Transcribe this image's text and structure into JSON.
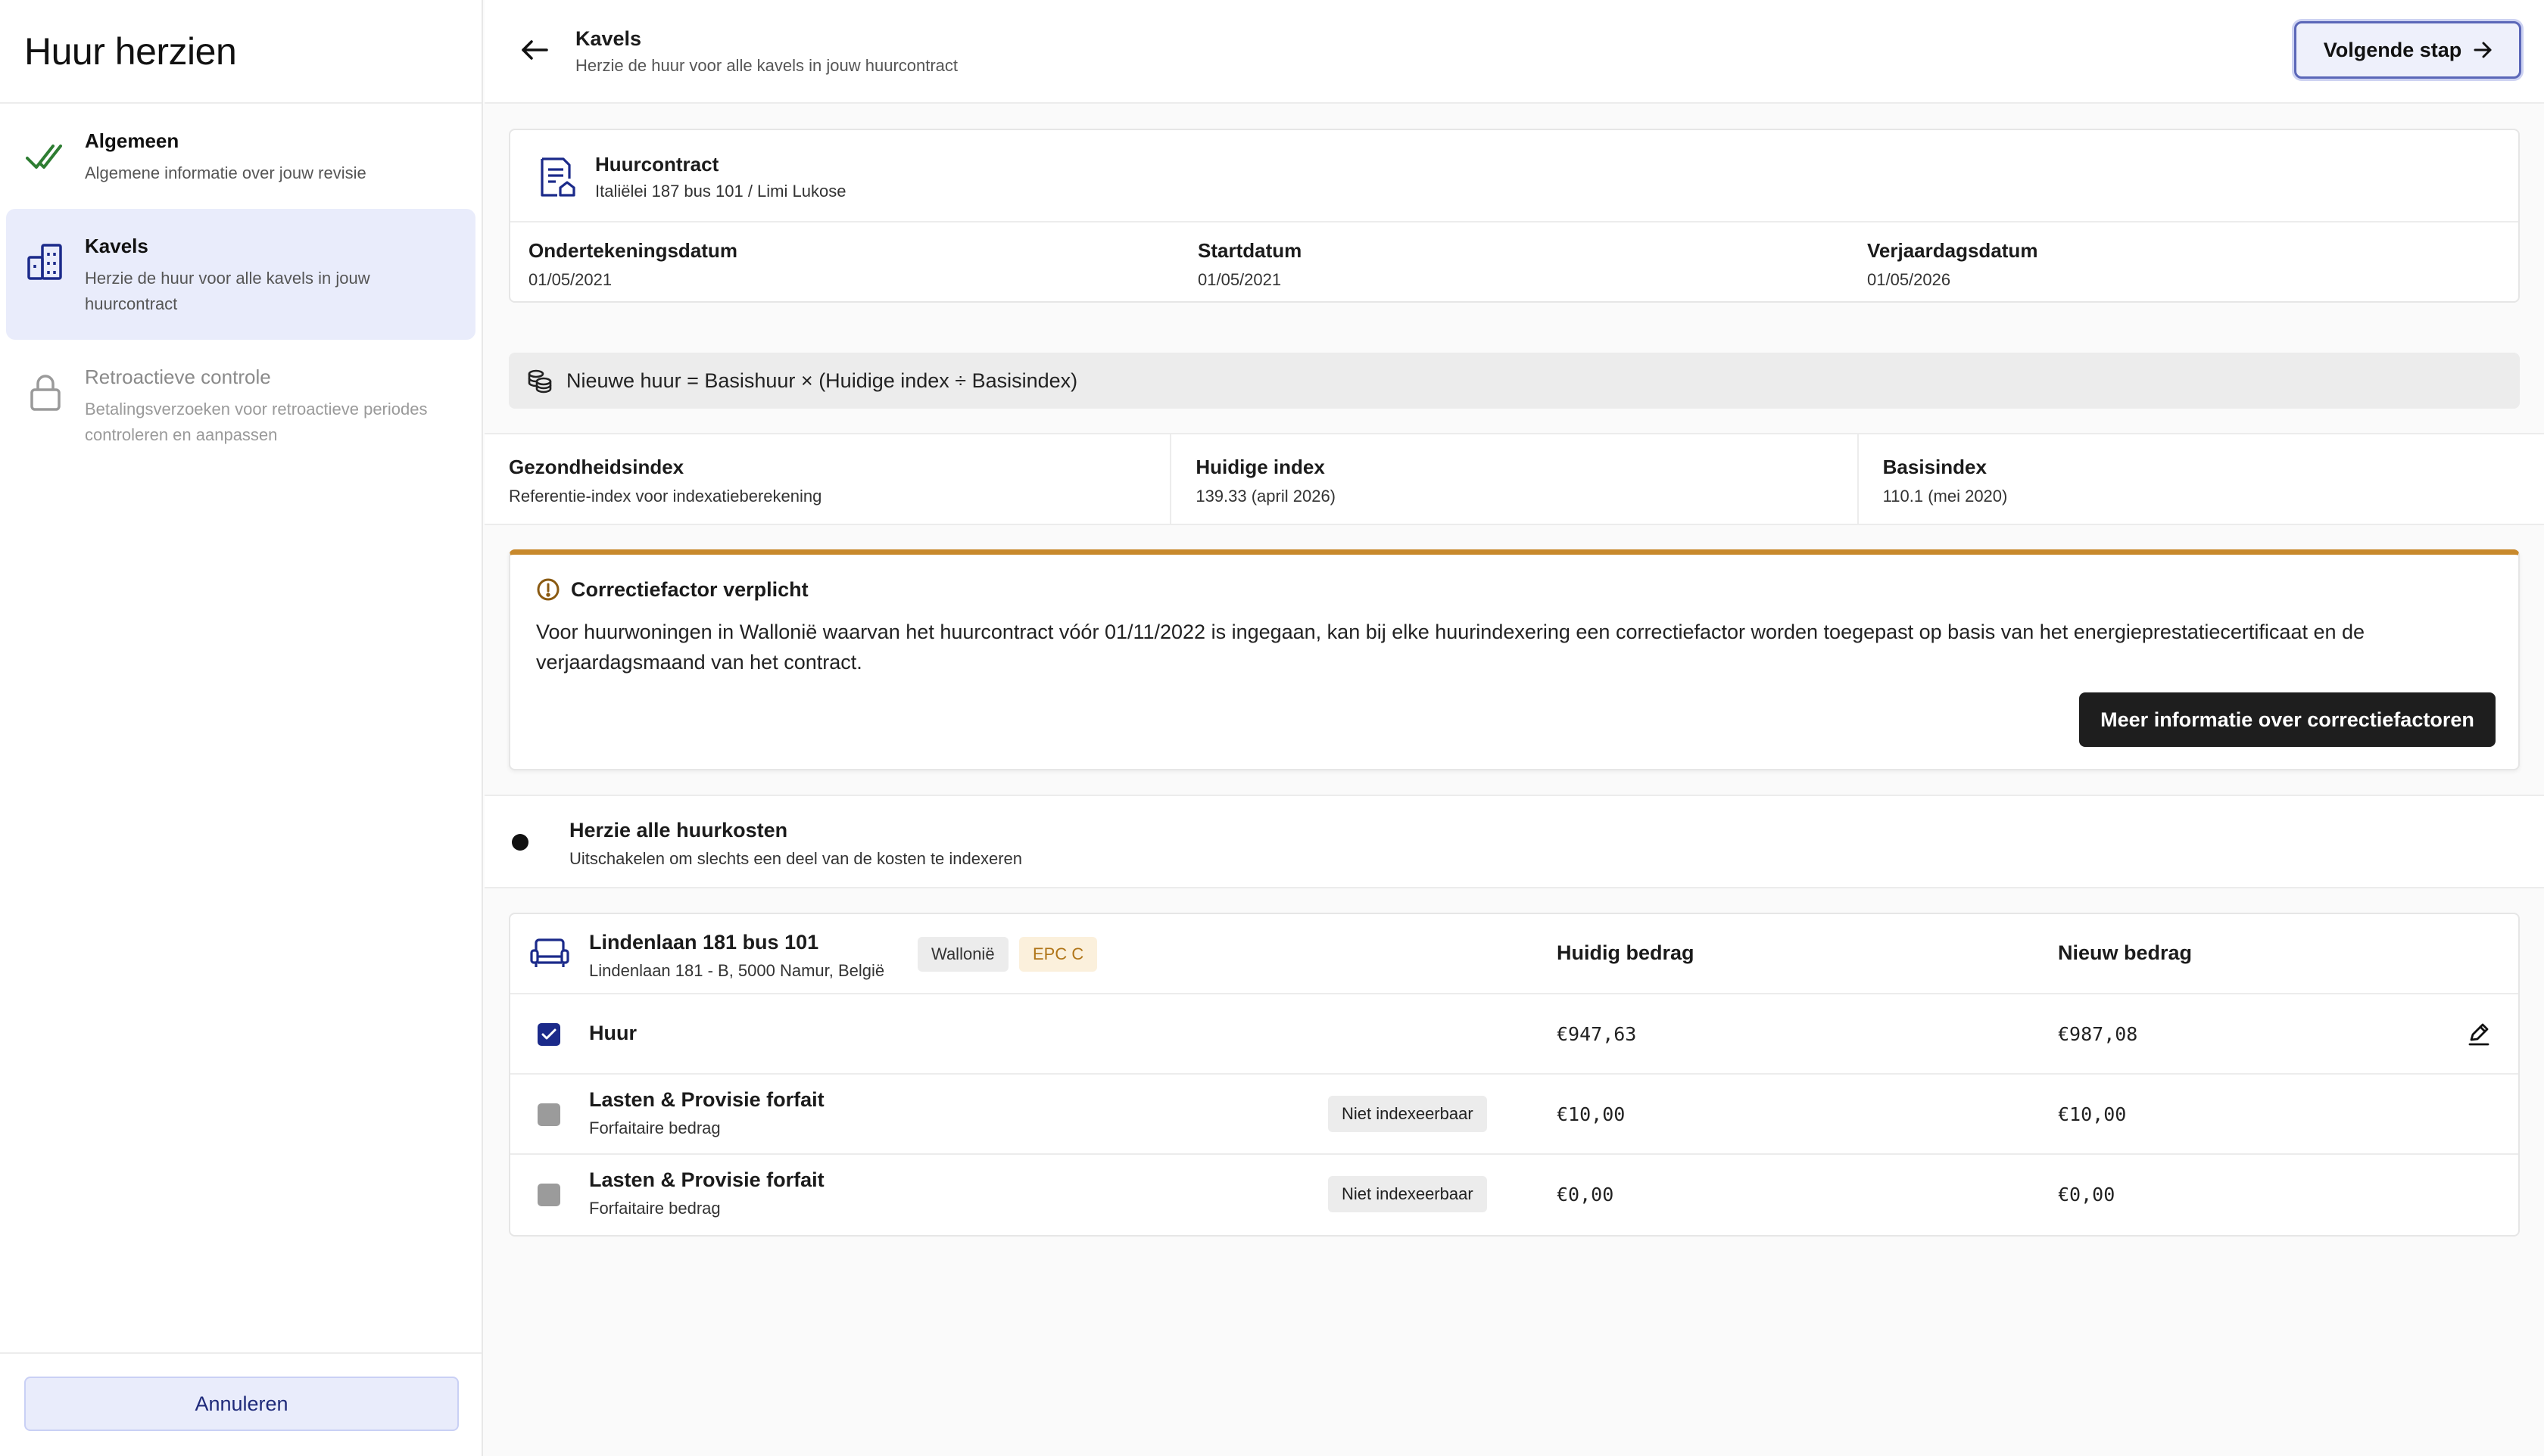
{
  "sidebar": {
    "title": "Huur herzien",
    "steps": [
      {
        "title": "Algemeen",
        "subtitle": "Algemene informatie over jouw revisie",
        "state": "done"
      },
      {
        "title": "Kavels",
        "subtitle": "Herzie de huur voor alle kavels in jouw huurcontract",
        "state": "active"
      },
      {
        "title": "Retroactieve controle",
        "subtitle": "Betalingsverzoeken voor retroactieve periodes controleren en aanpassen",
        "state": "locked"
      }
    ],
    "cancel_label": "Annuleren"
  },
  "header": {
    "title": "Kavels",
    "subtitle": "Herzie de huur voor alle kavels in jouw huurcontract",
    "next_label": "Volgende stap"
  },
  "contract": {
    "title": "Huurcontract",
    "subtitle": "Italiëlei 187 bus 101 / Limi Lukose",
    "dates": [
      {
        "label": "Ondertekeningsdatum",
        "value": "01/05/2021"
      },
      {
        "label": "Startdatum",
        "value": "01/05/2021"
      },
      {
        "label": "Verjaardagsdatum",
        "value": "01/05/2026"
      }
    ]
  },
  "formula": "Nieuwe huur = Basishuur × (Huidige index ÷ Basisindex)",
  "indices": [
    {
      "label": "Gezondheidsindex",
      "value": "Referentie-index voor indexatieberekening"
    },
    {
      "label": "Huidige index",
      "value": "139.33 (april 2026)"
    },
    {
      "label": "Basisindex",
      "value": "110.1 (mei 2020)"
    }
  ],
  "warning": {
    "title": "Correctiefactor verplicht",
    "body": "Voor huurwoningen in Wallonië waarvan het huurcontract vóór 01/11/2022 is ingegaan, kan bij elke huurindexering een correctiefactor worden toegepast op basis van het energieprestatiecertificaat en de verjaardagsmaand van het contract.",
    "button_label": "Meer informatie over correctiefactoren",
    "accent": "#c8892c"
  },
  "toggle": {
    "title": "Herzie alle huurkosten",
    "subtitle": "Uitschakelen om slechts een deel van de kosten te indexeren",
    "on": false
  },
  "lot": {
    "title": "Lindenlaan 181 bus 101",
    "subtitle": "Lindenlaan 181 - B, 5000 Namur, België",
    "region_tag": "Wallonië",
    "epc_tag": "EPC C",
    "col_current": "Huidig bedrag",
    "col_new": "Nieuw bedrag",
    "rows": [
      {
        "title": "Huur",
        "subtitle": "",
        "checked": true,
        "badge": "",
        "current": "€947,63",
        "new": "€987,08"
      },
      {
        "title": "Lasten & Provisie forfait",
        "subtitle": "Forfaitaire bedrag",
        "checked": false,
        "badge": "Niet indexeerbaar",
        "current": "€10,00",
        "new": "€10,00"
      },
      {
        "title": "Lasten & Provisie forfait",
        "subtitle": "Forfaitaire bedrag",
        "checked": false,
        "badge": "Niet indexeerbaar",
        "current": "€0,00",
        "new": "€0,00"
      }
    ]
  },
  "colors": {
    "brand": "#1b2a8a",
    "active_step_bg": "#e9ecfb",
    "done_check": "#2e7d32",
    "epc_tag_text": "#b07518"
  }
}
